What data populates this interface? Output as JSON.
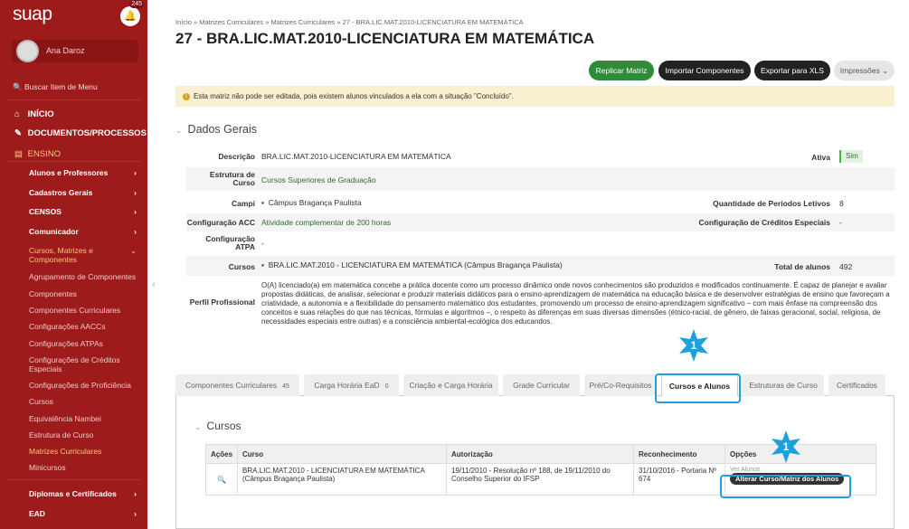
{
  "sidebar": {
    "logo": "suap",
    "notifications": "245",
    "user_name": "Ana Daroz",
    "search_placeholder": "Buscar Item de Menu",
    "menu": [
      {
        "label": "INÍCIO"
      },
      {
        "label": "DOCUMENTOS/PROCESSOS"
      },
      {
        "label": "ENSINO"
      }
    ],
    "sub": [
      {
        "label": "Alunos e Professores"
      },
      {
        "label": "Cadastros Gerais"
      },
      {
        "label": "CENSOS"
      },
      {
        "label": "Comunicador"
      },
      {
        "label": "Cursos, Matrizes e Componentes"
      },
      {
        "label": "Agrupamento de Componentes"
      },
      {
        "label": "Componentes"
      },
      {
        "label": "Componentes Curriculares"
      },
      {
        "label": "Configurações AACCs"
      },
      {
        "label": "Configurações ATPAs"
      },
      {
        "label": "Configurações de Créditos Especiais"
      },
      {
        "label": "Configurações de Proficiência"
      },
      {
        "label": "Cursos"
      },
      {
        "label": "Equivalência Nambei"
      },
      {
        "label": "Estrutura de Curso"
      },
      {
        "label": "Matrizes Curriculares"
      },
      {
        "label": "Minicursos"
      },
      {
        "label": "Diplomas e Certificados"
      },
      {
        "label": "EAD"
      }
    ]
  },
  "breadcrumb": "Início » Matrizes Curriculares » Matrizes Curriculares » 27 - BRA.LIC.MAT.2010-LICENCIATURA EM MATEMÁTICA",
  "title": "27 - BRA.LIC.MAT.2010-LICENCIATURA EM MATEMÁTICA",
  "actions": {
    "replicar": "Replicar Matriz",
    "importar": "Importar Componentes",
    "exportar": "Exportar para XLS",
    "impressoes": "Impressões"
  },
  "warning": "Esta matriz não pode ser editada, pois existem alunos vinculados a ela com a situação \"Concluído\".",
  "dados_gerais": {
    "title": "Dados Gerais",
    "descricao_label": "Descrição",
    "descricao": "BRA.LIC.MAT.2010-LICENCIATURA EM MATEMÁTICA",
    "ativa_label": "Ativa",
    "ativa": "Sim",
    "estrutura_label": "Estrutura de Curso",
    "estrutura": "Cursos Superiores de Graduação",
    "campi_label": "Campi",
    "campi": "Câmpus Bragança Paulista",
    "periodos_label": "Quantidade de Períodos Letivos",
    "periodos": "8",
    "acc_label": "Configuração ACC",
    "acc": "Atividade complementar de 200 horas",
    "creditos_label": "Configuração de Créditos Especiais",
    "creditos": "-",
    "atpa_label": "Configuração ATPA",
    "atpa": "-",
    "cursos_label": "Cursos",
    "cursos": "BRA.LIC.MAT.2010 - LICENCIATURA EM MATEMÁTICA (Câmpus Bragança Paulista)",
    "total_label": "Total de alunos",
    "total": "492",
    "perfil_label": "Perfil Profissional",
    "perfil": "O(A) licenciado(a) em matemática concebe a prática docente como um processo dinâmico onde novos conhecimentos são produzidos e modificados continuamente. É capaz de planejar e avaliar propostas didáticas, de analisar, selecionar e produzir materiais didáticos para o ensino-aprendizagem de matemática na educação básica e de desenvolver estratégias de ensino que favoreçam a criatividade, a autonomia e a flexibilidade do pensamento matemático dos estudantes, promovendo um processo de ensino-aprendizagem significativo – com mais ênfase na compreensão dos conceitos e suas relações do que nas técnicas, fórmulas e algoritmos –, o respeito às diferenças em suas diversas dimensões (étnico-racial, de gênero, de faixas geracional, social, religiosa, de necessidades especiais entre outras) e a consciência ambiental-ecológica dos educandos."
  },
  "tabs": [
    {
      "label": "Componentes Curriculares",
      "count": "45"
    },
    {
      "label": "Carga Horária EaD",
      "count": "0"
    },
    {
      "label": "Criação e Carga Horária",
      "count": ""
    },
    {
      "label": "Grade Curricular",
      "count": ""
    },
    {
      "label": "Pré/Co-Requisitos",
      "count": ""
    },
    {
      "label": "Cursos e Alunos",
      "count": ""
    },
    {
      "label": "Estruturas de Curso",
      "count": ""
    },
    {
      "label": "Certificados",
      "count": ""
    }
  ],
  "cursos_section": {
    "title": "Cursos",
    "headers": [
      "Ações",
      "Curso",
      "Autorização",
      "Reconhecimento",
      "Opções"
    ],
    "row": {
      "curso": "BRA.LIC.MAT.2010 - LICENCIATURA EM MATEMÁTICA (Câmpus Bragança Paulista)",
      "autorizacao": "19/11/2010 - Resolução nº 188, de 19/11/2010 do Conselho Superior do IFSP",
      "reconhecimento": "31/10/2016 - Portaria Nº 674",
      "ver_alunos": "Ver Alunos",
      "alterar": "Alterar Curso/Matriz dos Alunos"
    }
  },
  "markers": [
    "1",
    "1"
  ],
  "colors": {
    "sidebar": "#9e1b1b",
    "primary": "#2e8b3a",
    "dark": "#222222",
    "highlight": "#1ea0dc"
  }
}
